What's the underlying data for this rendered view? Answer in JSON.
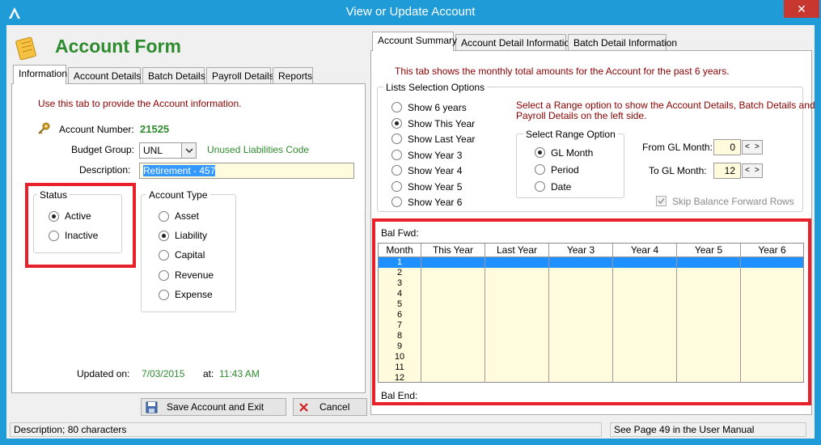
{
  "window": {
    "title": "View or Update Account",
    "close_label": "✕"
  },
  "form": {
    "heading": "Account Form"
  },
  "left_tabs": [
    "Information",
    "Account Details",
    "Batch Details",
    "Payroll Details",
    "Reports"
  ],
  "information": {
    "hint": "Use this tab to provide the Account information.",
    "account_number_label": "Account Number:",
    "account_number": "21525",
    "budget_group_label": "Budget Group:",
    "budget_group_value": "UNL",
    "budget_group_desc": "Unused Liabilities Code",
    "description_label": "Description:",
    "description_value": "Retirement - 457",
    "status": {
      "label": "Status",
      "options": [
        {
          "label": "Active",
          "selected": true
        },
        {
          "label": "Inactive",
          "selected": false
        }
      ]
    },
    "account_type": {
      "label": "Account Type",
      "options": [
        {
          "label": "Asset",
          "selected": false
        },
        {
          "label": "Liability",
          "selected": true
        },
        {
          "label": "Capital",
          "selected": false
        },
        {
          "label": "Revenue",
          "selected": false
        },
        {
          "label": "Expense",
          "selected": false
        }
      ]
    },
    "updated_on_label": "Updated on:",
    "updated_on": "7/03/2015",
    "at_label": "at:",
    "updated_at": "11:43 AM"
  },
  "buttons": {
    "save": "Save Account and Exit",
    "cancel": "Cancel"
  },
  "right_tabs": [
    "Account Summary",
    "Account Detail Information",
    "Batch Detail Information"
  ],
  "summary": {
    "hint": "This tab shows the monthly total amounts for the Account for the past 6 years.",
    "lists_label": "Lists Selection Options",
    "list_options": [
      {
        "label": "Show 6 years",
        "selected": false
      },
      {
        "label": "Show This Year",
        "selected": true
      },
      {
        "label": "Show Last Year",
        "selected": false
      },
      {
        "label": "Show Year 3",
        "selected": false
      },
      {
        "label": "Show Year 4",
        "selected": false
      },
      {
        "label": "Show Year 5",
        "selected": false
      },
      {
        "label": "Show Year 6",
        "selected": false
      }
    ],
    "range_hint_1": "Select a Range option to show the Account Details, Batch Details and",
    "range_hint_2": "Payroll Details on the left side.",
    "range_label": "Select Range Option",
    "range_options": [
      {
        "label": "GL Month",
        "selected": true
      },
      {
        "label": "Period",
        "selected": false
      },
      {
        "label": "Date",
        "selected": false
      }
    ],
    "from_label": "From GL Month:",
    "from_value": "0",
    "to_label": "To GL Month:",
    "to_value": "12",
    "spin_prev": "<",
    "spin_next": ">",
    "skip_label": "Skip Balance Forward Rows",
    "skip_checked": true,
    "bal_fwd_label": "Bal Fwd:",
    "bal_end_label": "Bal End:",
    "grid": {
      "columns": [
        "Month",
        "This Year",
        "Last Year",
        "Year 3",
        "Year 4",
        "Year 5",
        "Year 6"
      ],
      "months": [
        "1",
        "2",
        "3",
        "4",
        "5",
        "6",
        "7",
        "8",
        "9",
        "10",
        "11",
        "12"
      ]
    }
  },
  "statusbar": {
    "left": "Description; 80 characters",
    "right": "See Page 49 in the User Manual"
  },
  "colors": {
    "title_bar": "#1f9bd8",
    "highlight_box": "#e8202a",
    "grid_bg": "#fffbdc",
    "selected_row": "#1e90ff"
  }
}
